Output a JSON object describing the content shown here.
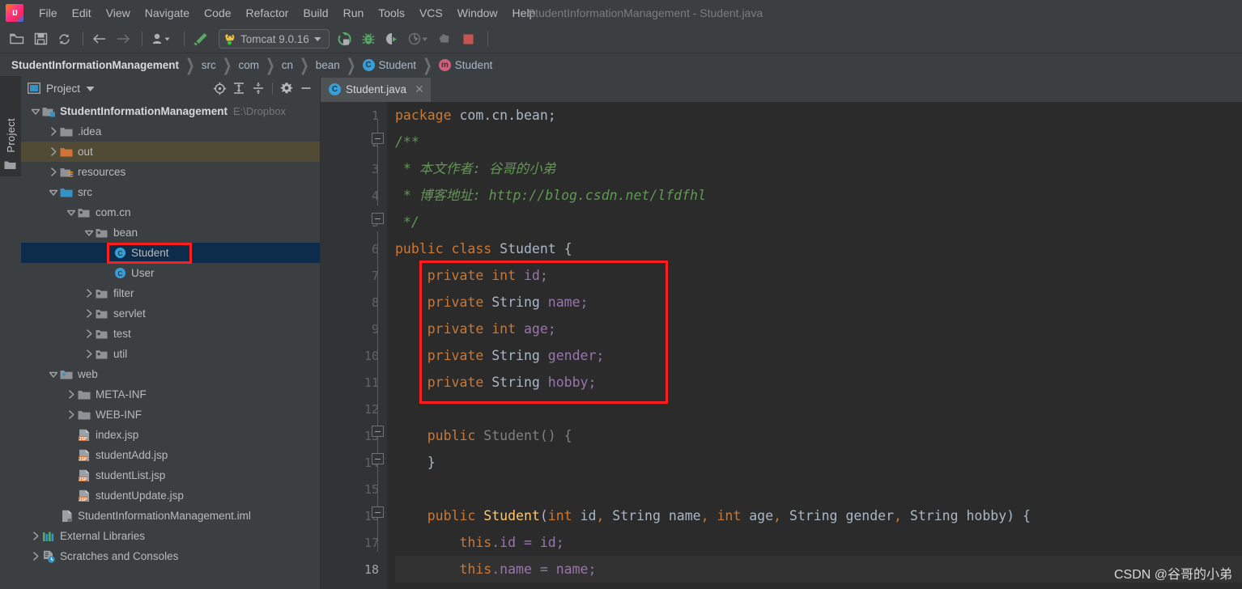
{
  "window": {
    "title": "StudentInformationManagement - Student.java"
  },
  "menubar": {
    "items": [
      {
        "label": "File",
        "mnemonic": "F"
      },
      {
        "label": "Edit",
        "mnemonic": "E"
      },
      {
        "label": "View",
        "mnemonic": "V"
      },
      {
        "label": "Navigate",
        "mnemonic": "N"
      },
      {
        "label": "Code",
        "mnemonic": "C"
      },
      {
        "label": "Refactor",
        "mnemonic": "R"
      },
      {
        "label": "Build",
        "mnemonic": "B"
      },
      {
        "label": "Run",
        "mnemonic": "u"
      },
      {
        "label": "Tools",
        "mnemonic": "T"
      },
      {
        "label": "VCS",
        "mnemonic": "S"
      },
      {
        "label": "Window",
        "mnemonic": "W"
      },
      {
        "label": "Help",
        "mnemonic": "H"
      }
    ]
  },
  "toolbar": {
    "open_title": "Open",
    "save_title": "Save All",
    "sync_title": "Synchronize",
    "back_title": "Back",
    "forward_title": "Forward",
    "profile_title": "Profile",
    "build_title": "Build Project",
    "run_config": "Tomcat 9.0.16",
    "run_title": "Run",
    "debug_title": "Debug",
    "run_coverage_title": "Run with Coverage",
    "profiler_title": "Profiler",
    "update_title": "Update Application",
    "stop_title": "Stop"
  },
  "breadcrumb": {
    "items": [
      {
        "label": "StudentInformationManagement",
        "icon": "project-icon",
        "bold": true
      },
      {
        "label": "src",
        "icon": ""
      },
      {
        "label": "com",
        "icon": ""
      },
      {
        "label": "cn",
        "icon": ""
      },
      {
        "label": "bean",
        "icon": ""
      },
      {
        "label": "Student",
        "icon": "class-icon"
      },
      {
        "label": "Student",
        "icon": "method-icon"
      }
    ],
    "separator": "❯"
  },
  "left_strip": {
    "project_tab": "Project"
  },
  "project_panel": {
    "title": "Project",
    "dropdown_icon": "chevron-down-icon",
    "header_buttons": [
      "locate-icon",
      "expand-all-icon",
      "collapse-all-icon",
      "settings-gear-icon",
      "hide-icon"
    ],
    "tree": [
      {
        "label": "StudentInformationManagement",
        "path": "E:\\Dropbox",
        "indent": 0,
        "twisty": "down",
        "icon": "module-icon",
        "bold": true,
        "state": "normal"
      },
      {
        "label": ".idea",
        "path": "",
        "indent": 1,
        "twisty": "right",
        "icon": "folder-icon",
        "bold": false,
        "state": "normal"
      },
      {
        "label": "out",
        "path": "",
        "indent": 1,
        "twisty": "right",
        "icon": "folder-orange-icon",
        "bold": false,
        "state": "excluded"
      },
      {
        "label": "resources",
        "path": "",
        "indent": 1,
        "twisty": "right",
        "icon": "folder-resources-icon",
        "bold": false,
        "state": "normal"
      },
      {
        "label": "src",
        "path": "",
        "indent": 1,
        "twisty": "down",
        "icon": "folder-source-icon",
        "bold": false,
        "state": "normal"
      },
      {
        "label": "com.cn",
        "path": "",
        "indent": 2,
        "twisty": "down",
        "icon": "package-icon",
        "bold": false,
        "state": "normal"
      },
      {
        "label": "bean",
        "path": "",
        "indent": 3,
        "twisty": "down",
        "icon": "package-icon",
        "bold": false,
        "state": "normal"
      },
      {
        "label": "Student",
        "path": "",
        "indent": 4,
        "twisty": "none",
        "icon": "class-icon",
        "bold": false,
        "state": "selected"
      },
      {
        "label": "User",
        "path": "",
        "indent": 4,
        "twisty": "none",
        "icon": "class-icon",
        "bold": false,
        "state": "normal"
      },
      {
        "label": "filter",
        "path": "",
        "indent": 3,
        "twisty": "right",
        "icon": "package-icon",
        "bold": false,
        "state": "normal"
      },
      {
        "label": "servlet",
        "path": "",
        "indent": 3,
        "twisty": "right",
        "icon": "package-icon",
        "bold": false,
        "state": "normal"
      },
      {
        "label": "test",
        "path": "",
        "indent": 3,
        "twisty": "right",
        "icon": "package-icon",
        "bold": false,
        "state": "normal"
      },
      {
        "label": "util",
        "path": "",
        "indent": 3,
        "twisty": "right",
        "icon": "package-icon",
        "bold": false,
        "state": "normal"
      },
      {
        "label": "web",
        "path": "",
        "indent": 1,
        "twisty": "down",
        "icon": "folder-web-icon",
        "bold": false,
        "state": "normal"
      },
      {
        "label": "META-INF",
        "path": "",
        "indent": 2,
        "twisty": "right",
        "icon": "folder-icon",
        "bold": false,
        "state": "normal"
      },
      {
        "label": "WEB-INF",
        "path": "",
        "indent": 2,
        "twisty": "right",
        "icon": "folder-icon",
        "bold": false,
        "state": "normal"
      },
      {
        "label": "index.jsp",
        "path": "",
        "indent": 2,
        "twisty": "none",
        "icon": "jsp-icon",
        "bold": false,
        "state": "normal"
      },
      {
        "label": "studentAdd.jsp",
        "path": "",
        "indent": 2,
        "twisty": "none",
        "icon": "jsp-icon",
        "bold": false,
        "state": "normal"
      },
      {
        "label": "studentList.jsp",
        "path": "",
        "indent": 2,
        "twisty": "none",
        "icon": "jsp-icon",
        "bold": false,
        "state": "normal"
      },
      {
        "label": "studentUpdate.jsp",
        "path": "",
        "indent": 2,
        "twisty": "none",
        "icon": "jsp-icon",
        "bold": false,
        "state": "normal"
      },
      {
        "label": "StudentInformationManagement.iml",
        "path": "",
        "indent": 1,
        "twisty": "none",
        "icon": "iml-icon",
        "bold": false,
        "state": "normal"
      },
      {
        "label": "External Libraries",
        "path": "",
        "indent": 0,
        "twisty": "right",
        "icon": "libraries-icon",
        "bold": false,
        "state": "normal"
      },
      {
        "label": "Scratches and Consoles",
        "path": "",
        "indent": 0,
        "twisty": "right",
        "icon": "scratches-icon",
        "bold": false,
        "state": "normal"
      }
    ]
  },
  "editor": {
    "tab": {
      "label": "Student.java",
      "icon": "class-icon",
      "close_icon": "close-icon"
    },
    "line_numbers": [
      1,
      2,
      3,
      4,
      5,
      6,
      7,
      8,
      9,
      10,
      11,
      12,
      13,
      14,
      15,
      16,
      17,
      18
    ],
    "current_line": 18,
    "code_lines": [
      {
        "n": 1,
        "text": "package com.cn.bean;"
      },
      {
        "n": 2,
        "text": "/**"
      },
      {
        "n": 3,
        "text": " * 本文作者: 谷哥的小弟"
      },
      {
        "n": 4,
        "text": " * 博客地址: http://blog.csdn.net/lfdfhl"
      },
      {
        "n": 5,
        "text": " */"
      },
      {
        "n": 6,
        "text": "public class Student {"
      },
      {
        "n": 7,
        "text": "    private int id;"
      },
      {
        "n": 8,
        "text": "    private String name;"
      },
      {
        "n": 9,
        "text": "    private int age;"
      },
      {
        "n": 10,
        "text": "    private String gender;"
      },
      {
        "n": 11,
        "text": "    private String hobby;"
      },
      {
        "n": 12,
        "text": ""
      },
      {
        "n": 13,
        "text": "    public Student() {"
      },
      {
        "n": 14,
        "text": "    }"
      },
      {
        "n": 15,
        "text": ""
      },
      {
        "n": 16,
        "text": "    public Student(int id, String name, int age, String gender, String hobby) {"
      },
      {
        "n": 17,
        "text": "        this.id = id;"
      },
      {
        "n": 18,
        "text": "        this.name = name;"
      }
    ],
    "tokens": {
      "kw_package": "package",
      "pkg_name": "com.cn.bean;",
      "comment_open": "/**",
      "comment_author": " * 本文作者: 谷哥的小弟",
      "comment_blog_label": " * 博客地址: ",
      "comment_blog_url": "http://blog.csdn.net/lfdfhl",
      "comment_close": " */",
      "kw_public": "public",
      "kw_class": "class",
      "class_name": "Student",
      "brace_open": "{",
      "brace_close": "}",
      "kw_private": "private",
      "type_int": "int",
      "type_String": "String",
      "field_id": "id;",
      "field_name": "name;",
      "field_age": "age;",
      "field_gender": "gender;",
      "field_hobby": "hobby;",
      "ctor_noargs": "Student() {",
      "ctor_name": "Student",
      "this_kw": "this",
      "assign_id": ".id = id;",
      "assign_name": ".name = name;"
    }
  },
  "annotations": {
    "highlight_color": "#ff1e1e",
    "boxes": [
      {
        "name": "fields-highlight-box"
      },
      {
        "name": "student-class-tree-highlight-box"
      }
    ]
  },
  "watermark": {
    "text": "CSDN @谷哥的小弟"
  },
  "colors": {
    "chrome_bg": "#3c3f41",
    "editor_bg": "#2b2b2b",
    "gutter_bg": "#313335",
    "selected_row": "#0d2c4b",
    "excluded_row": "#514b36",
    "keyword": "#cc7832",
    "field": "#9876aa",
    "comment": "#629755",
    "text": "#a9b7c6",
    "accent_blue": "#389fd6",
    "accent_pink": "#d0607c"
  }
}
